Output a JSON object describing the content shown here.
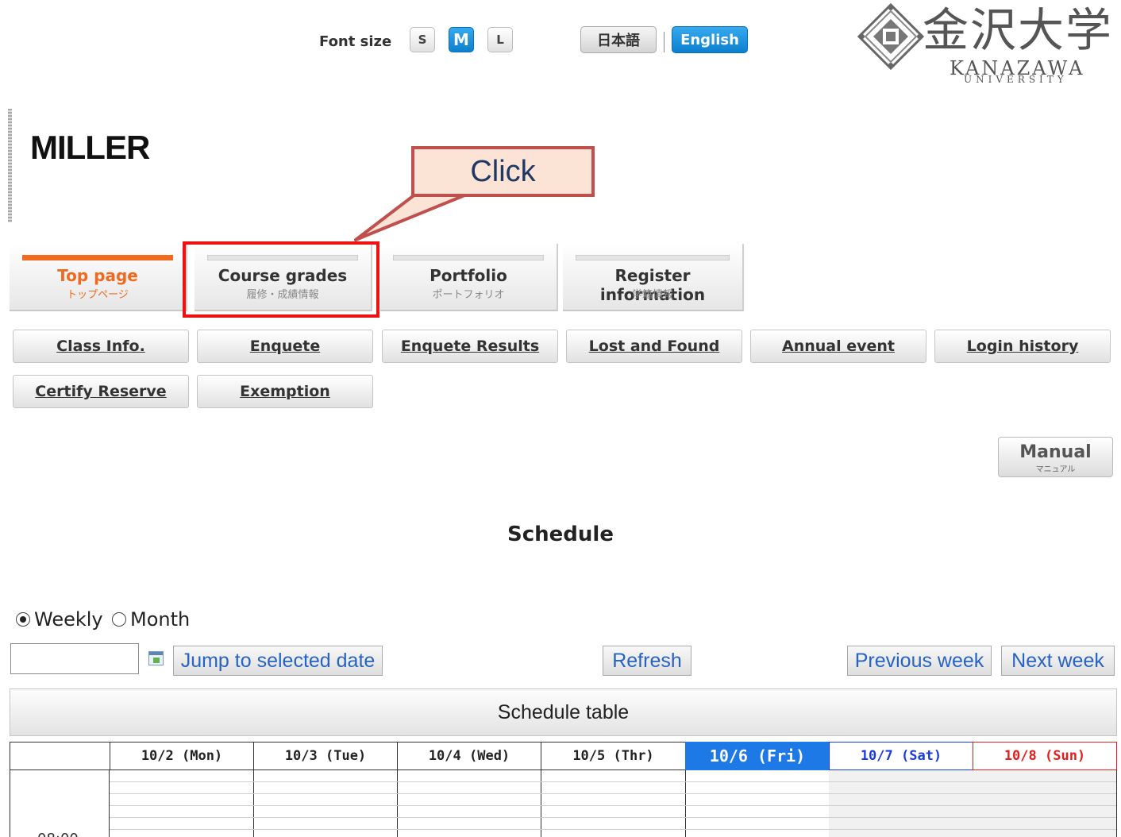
{
  "font_size": {
    "label": "Font size",
    "options": [
      "S",
      "M",
      "L"
    ],
    "selected": "M"
  },
  "language": {
    "japanese": "日本語",
    "english": "English",
    "selected": "English"
  },
  "logo": {
    "text_jp": "金沢大学",
    "text_en": "KANAZAWA",
    "text_sub": "UNIVERSITY"
  },
  "user": {
    "name": "MILLER"
  },
  "callout": {
    "text": "Click",
    "border_color": "#c0504d",
    "fill_color": "#fbe4d5"
  },
  "tabs": [
    {
      "label": "Top page",
      "sub": "トップページ",
      "active": true
    },
    {
      "label": "Course grades",
      "sub": "履修・成績情報",
      "active": false
    },
    {
      "label": "Portfolio",
      "sub": "ポートフォリオ",
      "active": false
    },
    {
      "label": "Register information",
      "sub": "学籍情報",
      "active": false
    }
  ],
  "subnav": [
    "Class Info.",
    "Enquete",
    "Enquete Results",
    "Lost and Found",
    "Annual event",
    "Login history",
    "Certify Reserve",
    "Exemption"
  ],
  "manual": {
    "label": "Manual",
    "sub": "マニュアル"
  },
  "schedule": {
    "title": "Schedule",
    "view_options": [
      "Weekly",
      "Month"
    ],
    "view_selected": "Weekly",
    "date_value": "",
    "jump_label": "Jump to selected date",
    "refresh_label": "Refresh",
    "prev_label": "Previous week",
    "next_label": "Next week",
    "table_title": "Schedule table",
    "days": [
      "10/2 (Mon)",
      "10/3 (Tue)",
      "10/4 (Wed)",
      "10/5 (Thr)",
      "10/6 (Fri)",
      "10/7 (Sat)",
      "10/8 (Sun)"
    ],
    "today_index": 4,
    "first_time": "08:00"
  },
  "colors": {
    "accent_orange": "#ef6a1f",
    "active_blue": "#1d79e6",
    "saturday": "#1a3ae0",
    "sunday": "#e41d1d",
    "highlight_red": "#ee1111",
    "link_blue": "#2763c2"
  }
}
